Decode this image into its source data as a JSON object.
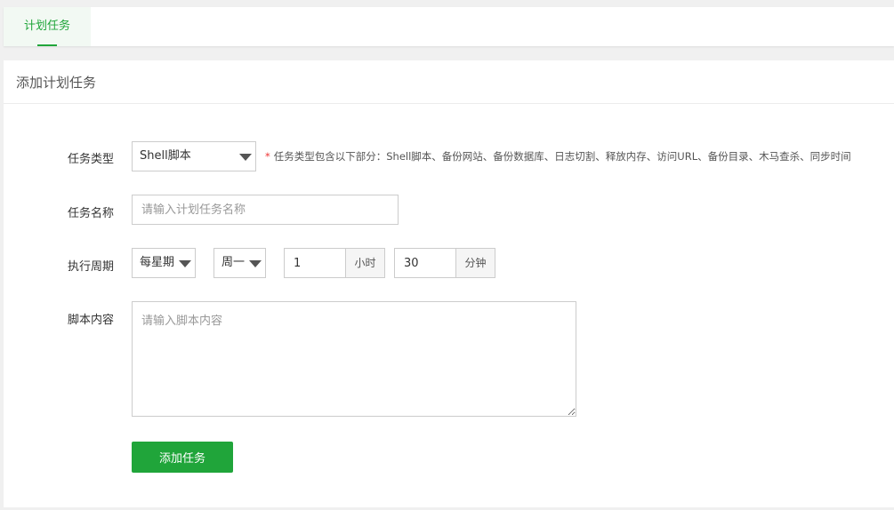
{
  "tabs": [
    {
      "label": "计划任务",
      "active": true
    }
  ],
  "panel": {
    "title": "添加计划任务"
  },
  "form": {
    "task_type": {
      "label": "任务类型",
      "selected": "Shell脚本",
      "hint_star": "*",
      "hint": "任务类型包含以下部分：Shell脚本、备份网站、备份数据库、日志切割、释放内存、访问URL、备份目录、木马查杀、同步时间"
    },
    "task_name": {
      "label": "任务名称",
      "placeholder": "请输入计划任务名称",
      "value": ""
    },
    "period": {
      "label": "执行周期",
      "cycle_selected": "每星期",
      "weekday_selected": "周一",
      "hour_value": "1",
      "hour_unit": "小时",
      "minute_value": "30",
      "minute_unit": "分钟"
    },
    "script": {
      "label": "脚本内容",
      "placeholder": "请输入脚本内容",
      "value": ""
    },
    "submit_label": "添加任务"
  },
  "colors": {
    "accent": "#20a53a",
    "required_star": "#ee3333",
    "background": "#f0f0f0"
  },
  "icons": {
    "select_caret": "caret-down-icon"
  }
}
